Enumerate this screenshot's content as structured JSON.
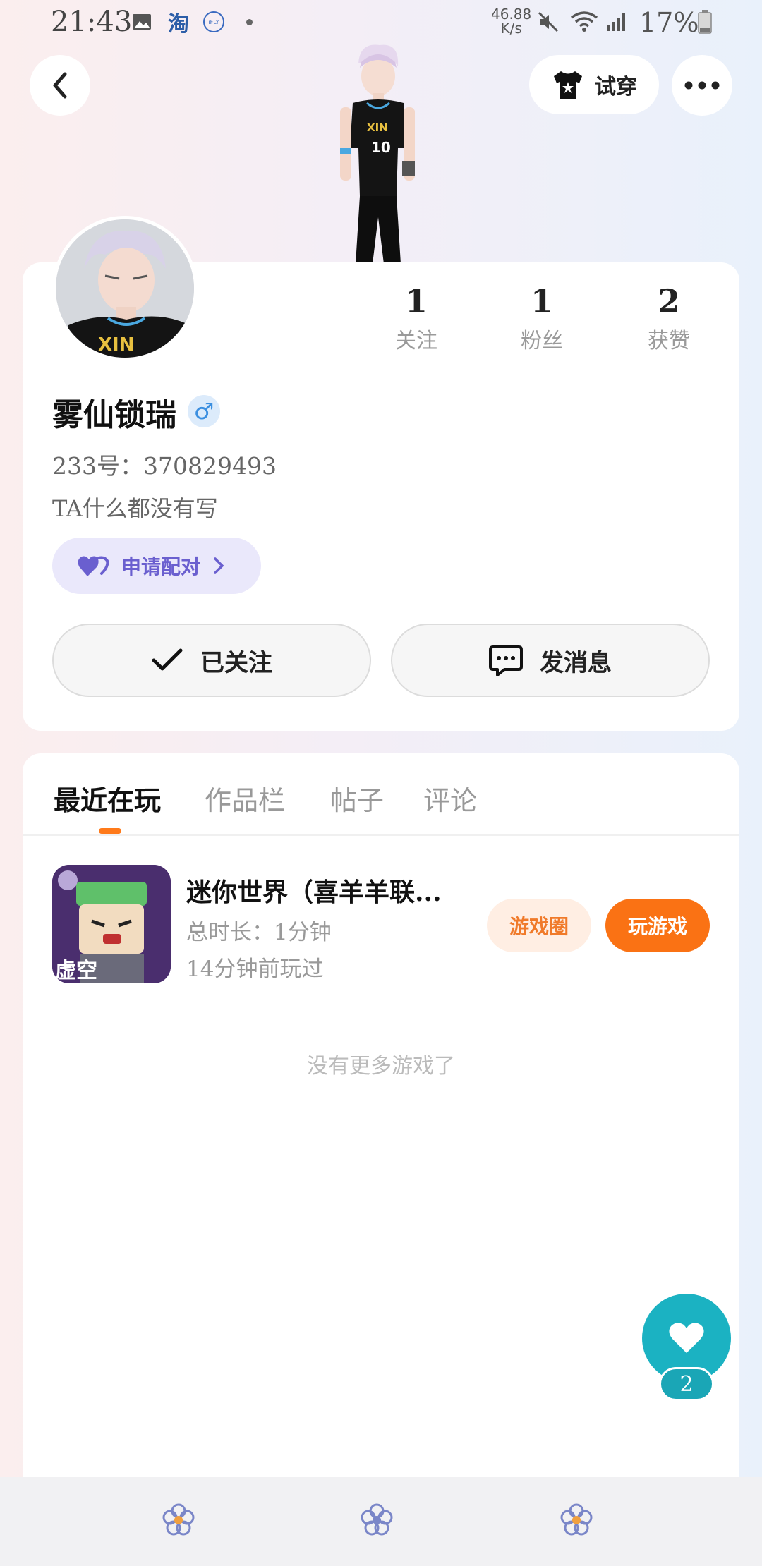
{
  "status_bar": {
    "time": "21:43",
    "net_speed": "46.88",
    "net_unit": "K/s",
    "battery": "17%",
    "icons": [
      "image-icon",
      "taobao-icon",
      "ifly-icon",
      "dot-icon",
      "mute-icon",
      "wifi-icon",
      "signal-icon",
      "battery-icon"
    ],
    "taobao_glyph": "淘",
    "ifly_label": "iFLY"
  },
  "header": {
    "try_on_label": "试穿"
  },
  "profile": {
    "nickname": "雾仙锁瑞",
    "gender_symbol": "♂",
    "uid": "233号：370829493",
    "bio": "TA什么都没有写",
    "pair_label": "申请配对",
    "stats": [
      {
        "value": "1",
        "label": "关注"
      },
      {
        "value": "1",
        "label": "粉丝"
      },
      {
        "value": "2",
        "label": "获赞"
      }
    ],
    "follow_label": "已关注",
    "message_label": "发消息"
  },
  "tabs": [
    "最近在玩",
    "作品栏",
    "帖子",
    "评论"
  ],
  "active_tab": 0,
  "recent_game": {
    "title": "迷你世界（喜羊羊联...",
    "duration": "总时长：1分钟",
    "last_played": "14分钟前玩过",
    "circle_label": "游戏圈",
    "play_label": "玩游戏"
  },
  "no_more_text": "没有更多游戏了",
  "like": {
    "count": "2"
  },
  "colors": {
    "accent_orange": "#fa7214",
    "like_teal": "#1bb2c2",
    "pair_purple": "#6a5fcf",
    "gender_blue": "#3b8fe0"
  }
}
